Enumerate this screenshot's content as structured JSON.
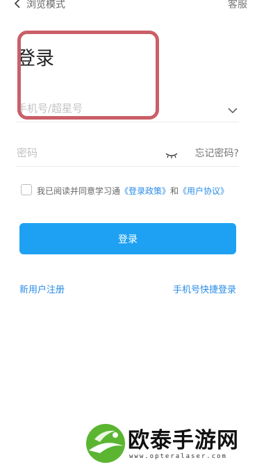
{
  "header": {
    "back_label": "浏览模式",
    "service_label": "客服"
  },
  "title": "登录",
  "phone_field": {
    "placeholder": "手机号/超星号"
  },
  "password_field": {
    "placeholder": "密码",
    "forgot_label": "忘记密码?"
  },
  "agreement": {
    "prefix": "我已阅读并同意学习通",
    "policy_link": "《登录政策》",
    "and": "和",
    "user_link": "《用户协议》"
  },
  "login_button_label": "登录",
  "register_label": "新用户注册",
  "quick_login_label": "手机号快捷登录",
  "watermark": {
    "name": "欧泰手游网",
    "url": "www.opteralaser.com"
  },
  "colors": {
    "accent": "#1ea1f2",
    "link": "#2a8ce6",
    "highlight": "#c95f68"
  },
  "icons": [
    "back-chevron-icon",
    "chevron-down-icon",
    "eye-closed-icon",
    "watermark-logo-icon"
  ]
}
